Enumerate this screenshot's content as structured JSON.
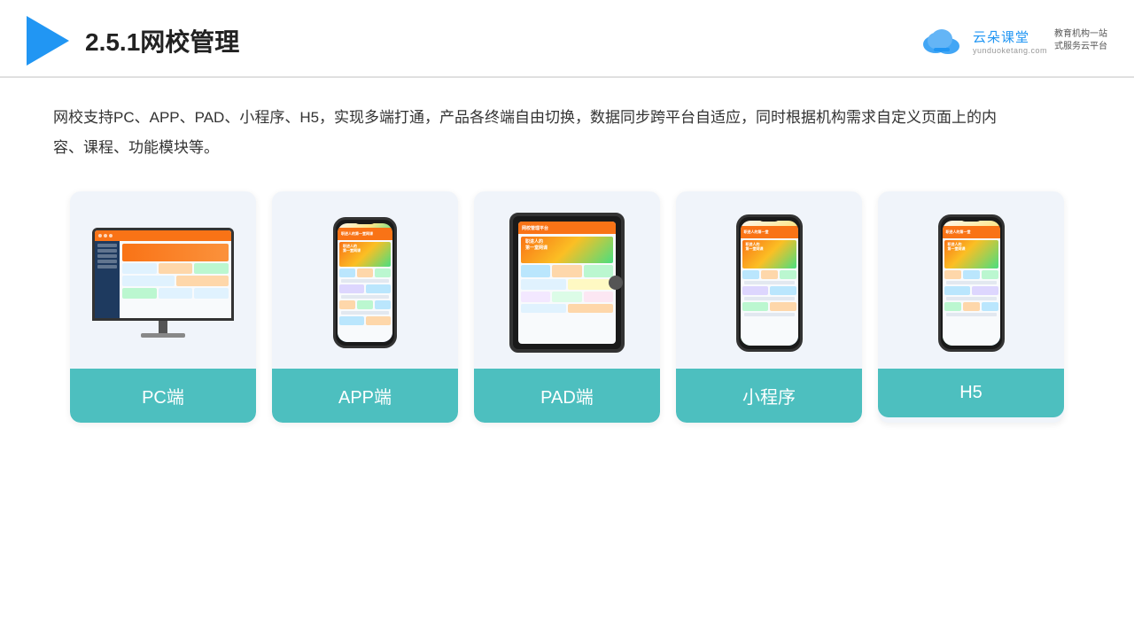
{
  "header": {
    "title": "2.5.1网校管理",
    "brand": {
      "name": "云朵课堂",
      "domain": "yunduoketang.com",
      "slogan_line1": "教育机构一站",
      "slogan_line2": "式服务云平台"
    }
  },
  "description": "网校支持PC、APP、PAD、小程序、H5，实现多端打通，产品各终端自由切换，数据同步跨平台自适应，同时根据机构需求自定义页面上的内容、课程、功能模块等。",
  "cards": [
    {
      "id": "pc",
      "label": "PC端"
    },
    {
      "id": "app",
      "label": "APP端"
    },
    {
      "id": "pad",
      "label": "PAD端"
    },
    {
      "id": "miniapp",
      "label": "小程序"
    },
    {
      "id": "h5",
      "label": "H5"
    }
  ],
  "colors": {
    "accent": "#4DBFBF",
    "blue": "#2196F3"
  }
}
